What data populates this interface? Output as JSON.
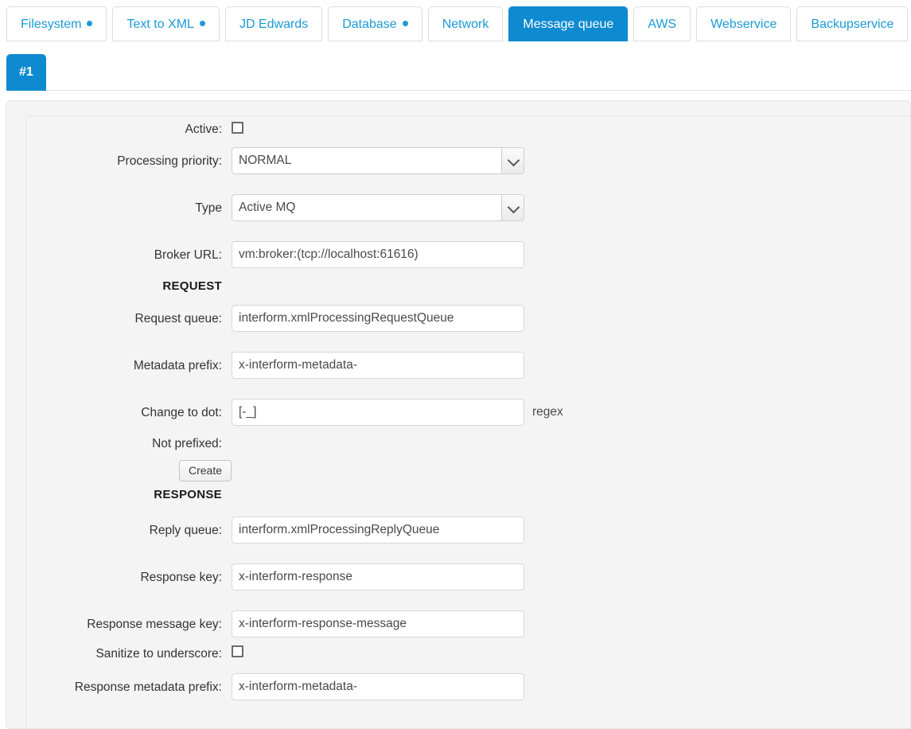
{
  "tabs": [
    {
      "label": "Filesystem",
      "dot": true,
      "active": false
    },
    {
      "label": "Text to XML",
      "dot": true,
      "active": false
    },
    {
      "label": "JD Edwards",
      "dot": false,
      "active": false
    },
    {
      "label": "Database",
      "dot": true,
      "active": false
    },
    {
      "label": "Network",
      "dot": false,
      "active": false
    },
    {
      "label": "Message queue",
      "dot": false,
      "active": true
    },
    {
      "label": "AWS",
      "dot": false,
      "active": false
    },
    {
      "label": "Webservice",
      "dot": false,
      "active": false
    },
    {
      "label": "Backupservice",
      "dot": false,
      "active": false
    }
  ],
  "subtabs": [
    {
      "label": "#1",
      "active": true
    }
  ],
  "colors": {
    "accent": "#0e8ad0",
    "tab_link": "#1b9ad6",
    "panel_bg": "#f4f4f4",
    "panel_border": "#e7e7e7"
  },
  "form": {
    "active": {
      "label": "Active:",
      "checked": false
    },
    "processing_priority": {
      "label": "Processing priority:",
      "value": "NORMAL",
      "options": [
        "NORMAL"
      ]
    },
    "type": {
      "label": "Type",
      "value": "Active MQ",
      "options": [
        "Active MQ"
      ]
    },
    "broker_url": {
      "label": "Broker URL:",
      "value": "vm:broker:(tcp://localhost:61616)",
      "placeholder": ""
    },
    "request_heading": "REQUEST",
    "request_queue": {
      "label": "Request queue:",
      "value": "interform.xmlProcessingRequestQueue",
      "placeholder": ""
    },
    "metadata_prefix": {
      "label": "Metadata prefix:",
      "value": "x-interform-metadata-",
      "placeholder": ""
    },
    "change_to_dot": {
      "label": "Change to dot:",
      "value": "[-_]",
      "placeholder": "",
      "suffix": "regex"
    },
    "not_prefixed": {
      "label": "Not prefixed:"
    },
    "create_button": {
      "label": "Create"
    },
    "response_heading": "RESPONSE",
    "reply_queue": {
      "label": "Reply queue:",
      "value": "interform.xmlProcessingReplyQueue",
      "placeholder": ""
    },
    "response_key": {
      "label": "Response key:",
      "value": "x-interform-response",
      "placeholder": ""
    },
    "response_message_key": {
      "label": "Response message key:",
      "value": "x-interform-response-message",
      "placeholder": ""
    },
    "sanitize_to_underscore": {
      "label": "Sanitize to underscore:",
      "checked": false
    },
    "response_metadata_prefix": {
      "label": "Response metadata prefix:",
      "value": "x-interform-metadata-",
      "placeholder": ""
    }
  }
}
